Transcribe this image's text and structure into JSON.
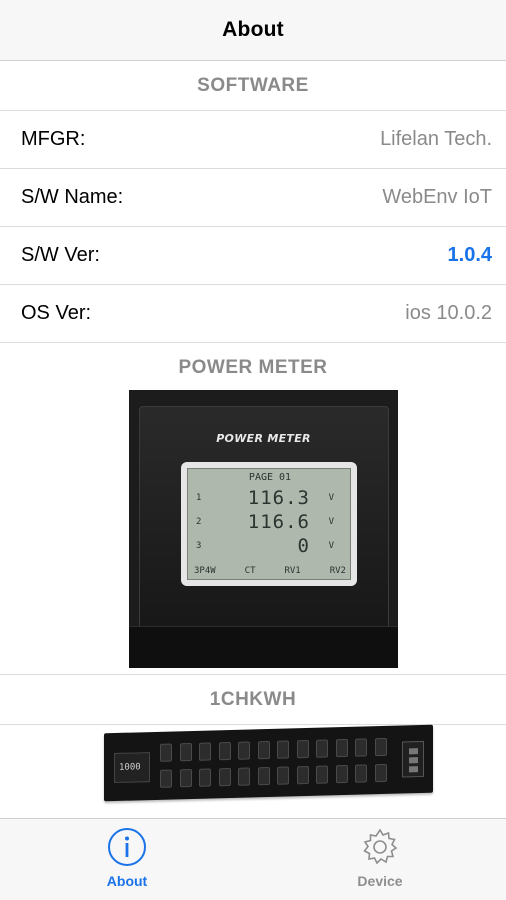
{
  "navbar": {
    "title": "About"
  },
  "software": {
    "header": "SOFTWARE",
    "rows": [
      {
        "label": "MFGR:",
        "value": "Lifelan Tech."
      },
      {
        "label": "S/W Name:",
        "value": "WebEnv IoT"
      },
      {
        "label": "S/W Ver:",
        "value": "1.0.4"
      },
      {
        "label": "OS Ver:",
        "value": "ios 10.0.2"
      }
    ]
  },
  "power_meter": {
    "header": "POWER METER",
    "brand": "POWER METER",
    "lcd": {
      "page": "PAGE 01",
      "lines": [
        {
          "idx": "1",
          "value": "116.3",
          "unit": "V"
        },
        {
          "idx": "2",
          "value": "116.6",
          "unit": "V"
        },
        {
          "idx": "3",
          "value": "0",
          "unit": "V"
        }
      ],
      "footer": [
        "3P4W",
        "CT",
        "RV1",
        "RV2"
      ]
    }
  },
  "pdu": {
    "header": "1CHKWH",
    "display": "1000"
  },
  "tabbar": {
    "tabs": [
      {
        "label": "About",
        "icon": "info-icon",
        "active": true
      },
      {
        "label": "Device",
        "icon": "gear-icon",
        "active": false
      }
    ]
  },
  "colors": {
    "accent": "#1a73e8",
    "section_header": "#8a8a8a",
    "value_gray": "#8a8a8a"
  }
}
